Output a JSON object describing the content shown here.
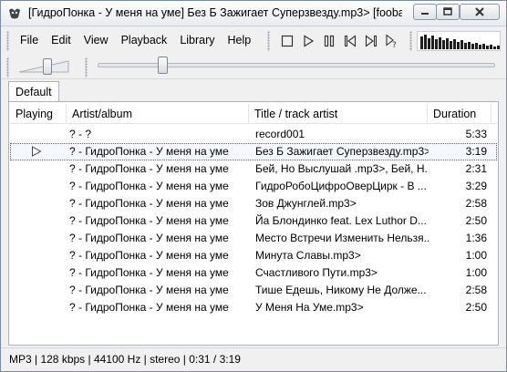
{
  "window": {
    "title": "[ГидроПонка - У меня на уме] Без Б Зажигает Суперзвезду.mp3>   [fooba"
  },
  "menu": [
    "File",
    "Edit",
    "View",
    "Playback",
    "Library",
    "Help"
  ],
  "toolbar": {
    "buttons": [
      "stop-icon",
      "play-icon",
      "pause-icon",
      "previous-icon",
      "next-icon",
      "random-icon"
    ]
  },
  "playback": {
    "volume_fraction": 0.55,
    "seek_fraction": 0.155
  },
  "tabs": [
    {
      "label": "Default"
    }
  ],
  "playlist": {
    "columns": [
      "Playing",
      "Artist/album",
      "Title / track artist",
      "Duration"
    ],
    "rows": [
      {
        "artist": "? - ?",
        "title": "record001",
        "duration": "5:33",
        "playing": false
      },
      {
        "artist": "? - ГидроПонка - У меня на уме",
        "title": "Без Б Зажигает Суперзвезду.mp3>",
        "duration": "3:19",
        "playing": true
      },
      {
        "artist": "? - ГидроПонка - У меня на уме",
        "title": "Бей, Но Выслушай .mp3>, Бей, Н...",
        "duration": "2:31",
        "playing": false
      },
      {
        "artist": "? - ГидроПонка - У меня на уме",
        "title": "ГидроРобоЦифроОверЦирк - В ...",
        "duration": "3:29",
        "playing": false
      },
      {
        "artist": "? - ГидроПонка - У меня на уме",
        "title": "Зов Джунглей.mp3>",
        "duration": "2:58",
        "playing": false
      },
      {
        "artist": "? - ГидроПонка - У меня на уме",
        "title": "Йа Блондинко feat. Lex Luthor  D...",
        "duration": "2:50",
        "playing": false
      },
      {
        "artist": "? - ГидроПонка - У меня на уме",
        "title": "Место Встречи Изменить Нельзя...",
        "duration": "1:36",
        "playing": false
      },
      {
        "artist": "? - ГидроПонка - У меня на уме",
        "title": "Минута Славы.mp3>",
        "duration": "1:00",
        "playing": false
      },
      {
        "artist": "? - ГидроПонка - У меня на уме",
        "title": "Счастливого Пути.mp3>",
        "duration": "1:00",
        "playing": false
      },
      {
        "artist": "? - ГидроПонка - У меня на уме",
        "title": "Тише Едешь, Никому Не Долже...",
        "duration": "2:58",
        "playing": false
      },
      {
        "artist": "? - ГидроПонка - У меня на уме",
        "title": "У Меня На Уме.mp3>",
        "duration": "2:50",
        "playing": false
      }
    ]
  },
  "status": {
    "text": "MP3 | 128 kbps | 44100 Hz | stereo | 0:31 / 3:19"
  }
}
